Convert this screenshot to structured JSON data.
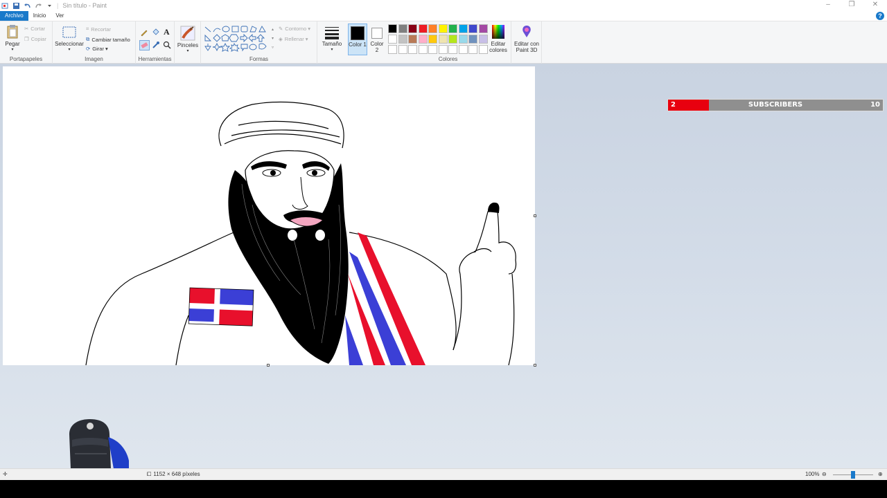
{
  "window": {
    "title": "Sin título - Paint",
    "controls": [
      "–",
      "❐",
      "✕"
    ]
  },
  "menu": {
    "tabs": [
      {
        "label": "Archivo",
        "active": true
      },
      {
        "label": "Inicio",
        "active": false
      },
      {
        "label": "Ver",
        "active": false
      }
    ],
    "help": "?"
  },
  "ribbon": {
    "clipboard": {
      "label": "Portapapeles",
      "paste": "Pegar",
      "cut": "Cortar",
      "copy": "Copiar"
    },
    "image": {
      "label": "Imagen",
      "select": "Seleccionar",
      "crop": "Recortar",
      "resize": "Cambiar tamaño",
      "rotate": "Girar ▾"
    },
    "tools": {
      "label": "Herramientas"
    },
    "brushes": {
      "label": "Pinceles"
    },
    "shapes": {
      "label": "Formas",
      "outline": "Contorno ▾",
      "fill": "Rellenar ▾"
    },
    "size": {
      "label": "Tamaño"
    },
    "color1": {
      "label": "Color 1",
      "color": "#000000"
    },
    "color2": {
      "label": "Color 2",
      "color": "#ffffff"
    },
    "colors": {
      "label": "Colores",
      "palette_row1": [
        "#000000",
        "#7f7f7f",
        "#880015",
        "#ed1c24",
        "#ff7f27",
        "#fff200",
        "#22b14c",
        "#00a2e8",
        "#3f48cc",
        "#a349a4"
      ],
      "palette_row2": [
        "#ffffff",
        "#c3c3c3",
        "#b97a57",
        "#ffaec9",
        "#ffc90e",
        "#efe4b0",
        "#b5e61d",
        "#99d9ea",
        "#7092be",
        "#c8bfe7"
      ],
      "palette_row3": [
        "#ffffff",
        "#ffffff",
        "#ffffff",
        "#ffffff",
        "#ffffff",
        "#ffffff",
        "#ffffff",
        "#ffffff",
        "#ffffff",
        "#ffffff"
      ]
    },
    "edit_colors": "Editar colores",
    "paint3d": "Editar con Paint 3D"
  },
  "overlay": {
    "sub_left": "2",
    "sub_label": "SUBSCRIBERS",
    "sub_right": "10",
    "sub_progress": 0.2
  },
  "status": {
    "dimensions": "1152 × 648 píxeles",
    "zoom": "100%"
  }
}
